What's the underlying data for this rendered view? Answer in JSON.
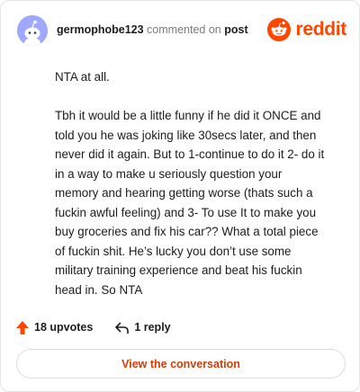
{
  "header": {
    "username": "germophobe123",
    "action_text": "commented on",
    "post_link": "post",
    "logo_text": "reddit"
  },
  "comment": {
    "paragraphs": [
      "NTA at all.",
      "Tbh it would be a little funny if he did it ONCE and told you he was joking like 30secs later, and then never did it again. But to 1-continue to do it 2- do it in a way to make u seriously question your memory and hearing getting worse (thats such a fuckin awful feeling) and 3- To use It to make you buy groceries and fix his car?? What a total piece of fuckin shit. He’s lucky you don’t use some military training experience and beat his fuckin head in. So NTA"
    ]
  },
  "stats": {
    "upvotes": "18 upvotes",
    "replies": "1 reply"
  },
  "actions": {
    "view_conversation": "View the conversation"
  },
  "icons": {
    "avatar": "snoo-avatar-icon",
    "logo": "reddit-logo-icon",
    "upvote": "upvote-arrow-icon",
    "reply": "reply-arrow-icon"
  },
  "colors": {
    "brand": "#ff4500",
    "link_text": "#d93a00",
    "avatar_bg": "#9ea8ff",
    "muted_text": "#7c7c7c",
    "border": "#e4e4e4"
  }
}
